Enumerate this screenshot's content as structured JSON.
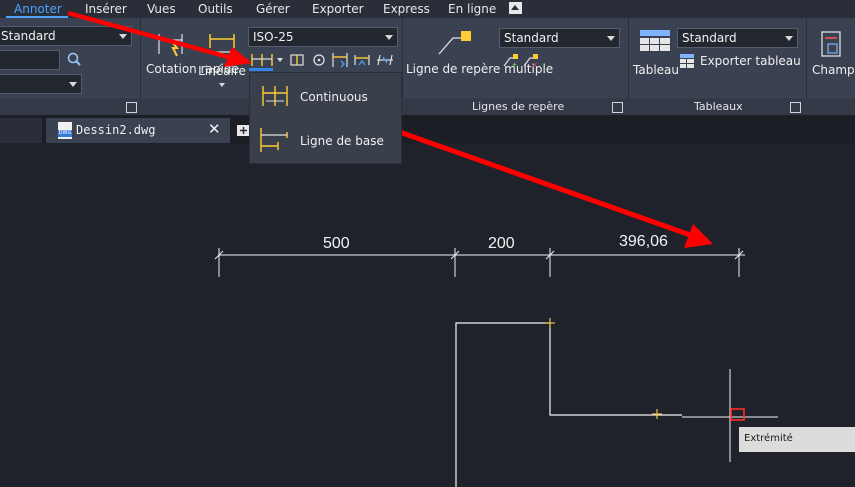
{
  "menubar": {
    "items": [
      "Annoter",
      "Insérer",
      "Vues",
      "Outils",
      "Gérer",
      "Exporter",
      "Express",
      "En ligne"
    ],
    "active": "Annoter"
  },
  "ribbon": {
    "text_style_value": "Standard",
    "cotation_rapide_label": "Cotation rapide",
    "lineaire_label": "Linéaire",
    "dim_style_value": "ISO-25",
    "ligne_repere_label": "Ligne de repère multiple",
    "leader_style_value": "Standard",
    "tableau_label": "Tableau",
    "table_style_value": "Standard",
    "exporter_tableau_label": "Exporter tableau",
    "champ_label": "Champ",
    "panel_titles": {
      "lignes_repere": "Lignes de repère",
      "tableaux": "Tableaux"
    }
  },
  "flyout": {
    "items": [
      "Continuous",
      "Ligne de base"
    ]
  },
  "document_tab": {
    "filename": "Dessin2.dwg",
    "badge": "DWG"
  },
  "drawing": {
    "dimensions": [
      "500",
      "200",
      "396,06"
    ],
    "tooltip": "Extrémité"
  },
  "colors": {
    "accent": "#4aa3ff",
    "annotation_arrow": "#ff0000",
    "dimension_icon": "#ffcc33",
    "canvas": "#1f222a",
    "ribbon": "#3a4150"
  }
}
